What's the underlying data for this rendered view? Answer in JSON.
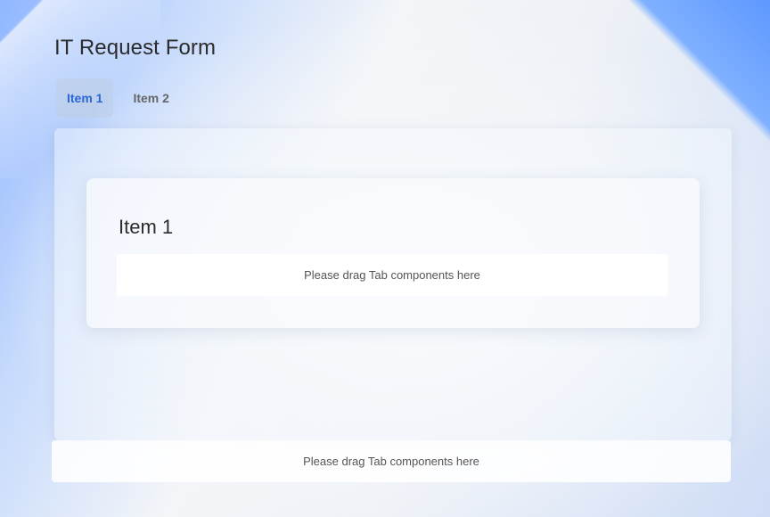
{
  "page": {
    "title": "IT Request Form"
  },
  "tabs": [
    {
      "label": "Item 1",
      "active": true
    },
    {
      "label": "Item 2",
      "active": false
    }
  ],
  "panel": {
    "heading": "Item 1",
    "dropzone_text": "Please drag Tab components here"
  },
  "footer_dropzone": {
    "text": "Please drag Tab components here"
  },
  "colors": {
    "accent": "#2c66d4",
    "active_tab_bg": "#c3cfe0",
    "corner_blue": "#5e98ff"
  }
}
